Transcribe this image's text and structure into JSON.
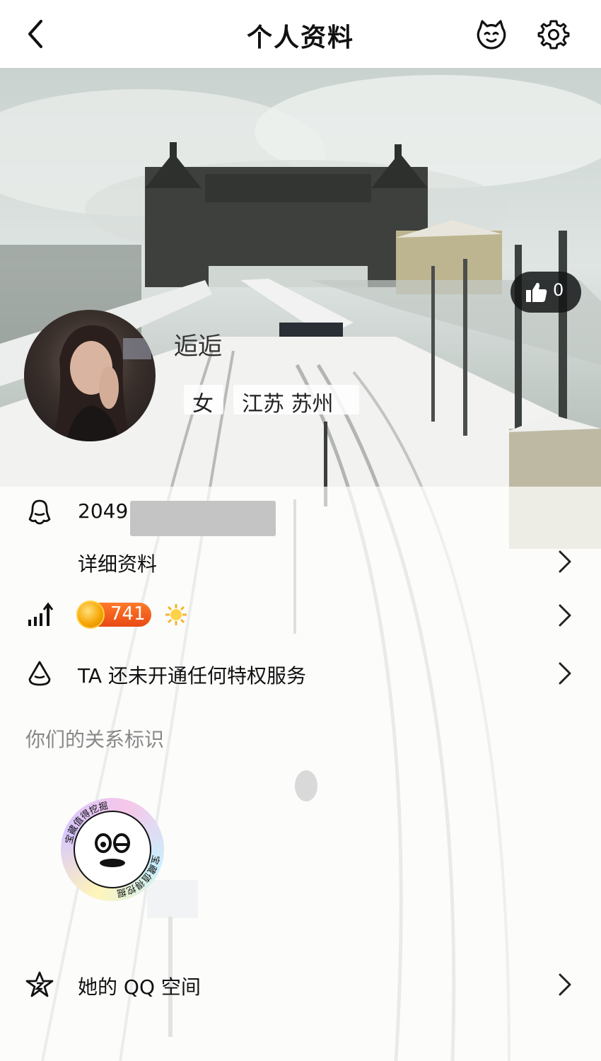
{
  "header": {
    "title": "个人资料",
    "icons": {
      "back": "back-arrow-icon",
      "pet": "pet-face-icon",
      "settings": "gear-icon"
    }
  },
  "profile": {
    "nickname": "逅逅",
    "gender": "女",
    "location": "江苏 苏州",
    "likes": "0"
  },
  "info": {
    "qq_number_visible": "2049",
    "detail_label": "详细资料",
    "level_value": "741",
    "privilege_text": "TA 还未开通任何特权服务",
    "relationship_title": "你们的关系标识",
    "badge_text": "宝藏值得挖掘",
    "qzone_label": "她的 QQ 空间"
  },
  "colors": {
    "accent_orange": "#e84a12",
    "coin_gold": "#f5a300",
    "text_gray": "#888888"
  }
}
